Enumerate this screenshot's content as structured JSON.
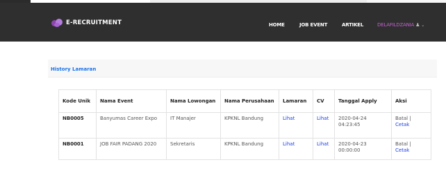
{
  "brand": {
    "name": "E-RECRUITMENT"
  },
  "nav": {
    "home": "HOME",
    "job_event": "JOB EVENT",
    "artikel": "ARTIKEL",
    "user": "DELAFILDZANIA"
  },
  "panel": {
    "title": "History Lamaran"
  },
  "table": {
    "headers": [
      "Kode Unik",
      "Nama Event",
      "Nama Lowongan",
      "Nama Perusahaan",
      "Lamaran",
      "CV",
      "Tanggal Apply",
      "Aksi"
    ],
    "rows": [
      {
        "kode": "NB0005",
        "event": "Banyumas Career Expo",
        "lowongan": "IT Manajer",
        "perusahaan": "KPKNL Bandung",
        "lamaran": "Lihat",
        "cv": "Lihat",
        "tanggal": "2020-04-24 04:23:45",
        "aksi_batal": "Batal |",
        "aksi_cetak": "Cetak"
      },
      {
        "kode": "NB0001",
        "event": "JOB FAIR PADANG 2020",
        "lowongan": "Sekretaris",
        "perusahaan": "KPKNL Bandung",
        "lamaran": "Lihat",
        "cv": "Lihat",
        "tanggal": "2020-04-23 00:00:00",
        "aksi_batal": "Batal |",
        "aksi_cetak": "Cetak"
      }
    ]
  }
}
